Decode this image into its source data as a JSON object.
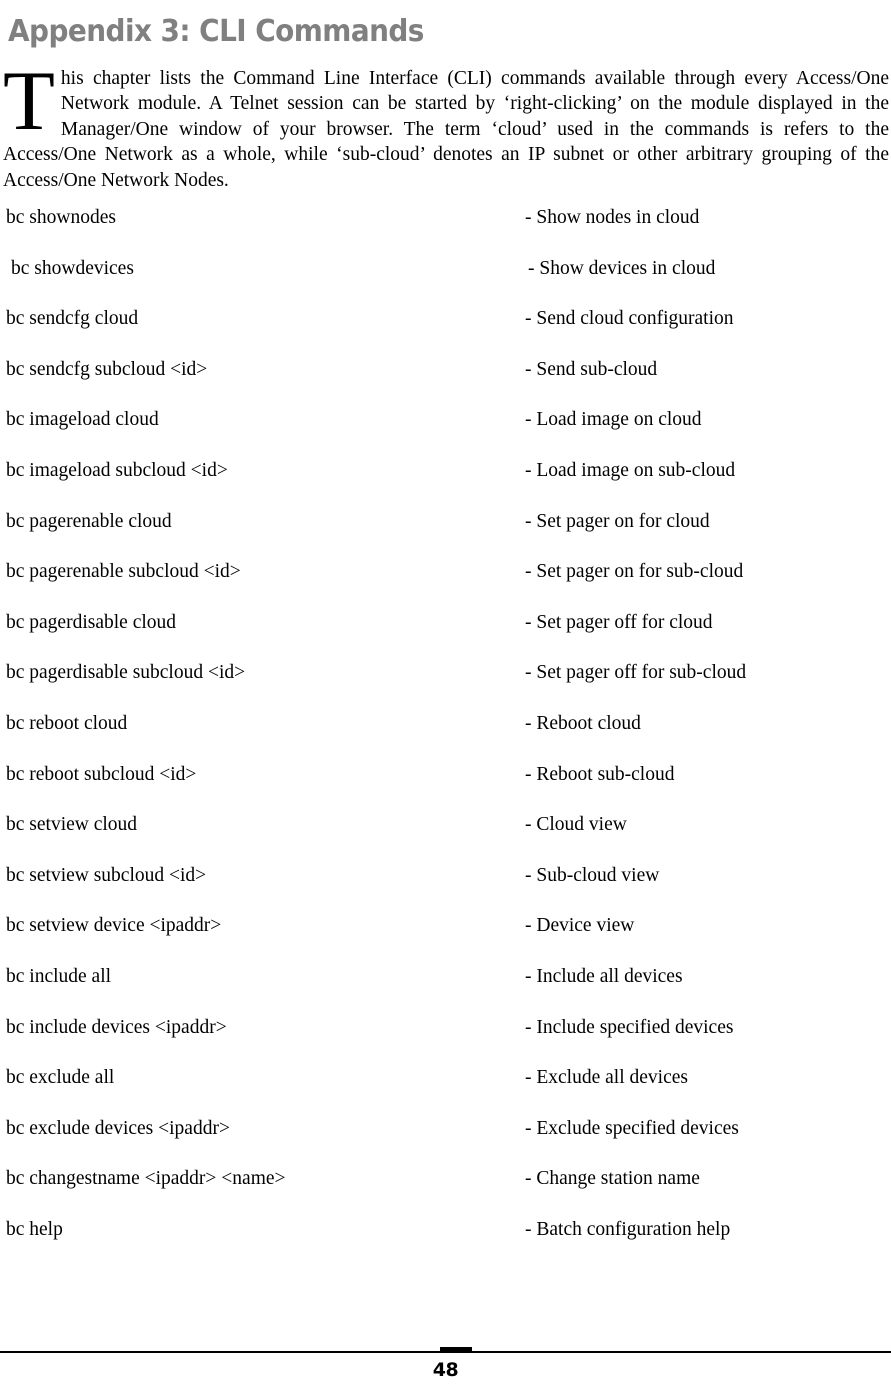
{
  "heading": {
    "title": "Appendix 3: CLI Commands",
    "color": "#808080"
  },
  "intro": {
    "dropcap": "T",
    "text": "his chapter lists the Command Line Interface (CLI) commands available through every Access/One Network module. A Telnet session can be started by ‘right-clicking’ on the module displayed in the Manager/One window of your browser. The term ‘cloud’ used in the commands is refers to the Access/One Network as a whole, while ‘sub-cloud’ denotes an IP subnet or other arbitrary grouping of the Access/One Network Nodes."
  },
  "commands": [
    {
      "name": "bc shownodes",
      "desc": "- Show nodes in cloud"
    },
    {
      "name": "bc showdevices",
      "desc": "- Show devices in cloud"
    },
    {
      "name": "bc sendcfg cloud",
      "desc": "- Send cloud configuration"
    },
    {
      "name": "bc sendcfg subcloud <id>",
      "desc": "- Send sub-cloud"
    },
    {
      "name": "bc imageload cloud",
      "desc": "- Load image on cloud"
    },
    {
      "name": "bc imageload subcloud <id>",
      "desc": "- Load image on sub-cloud"
    },
    {
      "name": "bc pagerenable cloud",
      "desc": "- Set pager on for cloud"
    },
    {
      "name": "bc pagerenable subcloud <id>",
      "desc": "- Set pager on for sub-cloud"
    },
    {
      "name": "bc pagerdisable cloud",
      "desc": "- Set pager off for cloud"
    },
    {
      "name": "bc pagerdisable subcloud <id>",
      "desc": "- Set pager off for sub-cloud"
    },
    {
      "name": "bc reboot cloud",
      "desc": "- Reboot cloud"
    },
    {
      "name": "bc reboot subcloud <id>",
      "desc": "- Reboot sub-cloud"
    },
    {
      "name": "bc setview cloud",
      "desc": "- Cloud view"
    },
    {
      "name": "bc setview subcloud <id>",
      "desc": "- Sub-cloud view"
    },
    {
      "name": "bc setview device <ipaddr>",
      "desc": "- Device view"
    },
    {
      "name": "bc include all",
      "desc": "- Include all devices"
    },
    {
      "name": "bc include devices <ipaddr>",
      "desc": "- Include specified devices"
    },
    {
      "name": "bc exclude all",
      "desc": "- Exclude all devices"
    },
    {
      "name": "bc exclude devices <ipaddr>",
      "desc": "- Exclude specified devices"
    },
    {
      "name": "bc changestname <ipaddr> <name>",
      "desc": "- Change station name"
    },
    {
      "name": "bc help",
      "desc": "- Batch configuration help"
    }
  ],
  "footer": {
    "page_number": "48"
  }
}
